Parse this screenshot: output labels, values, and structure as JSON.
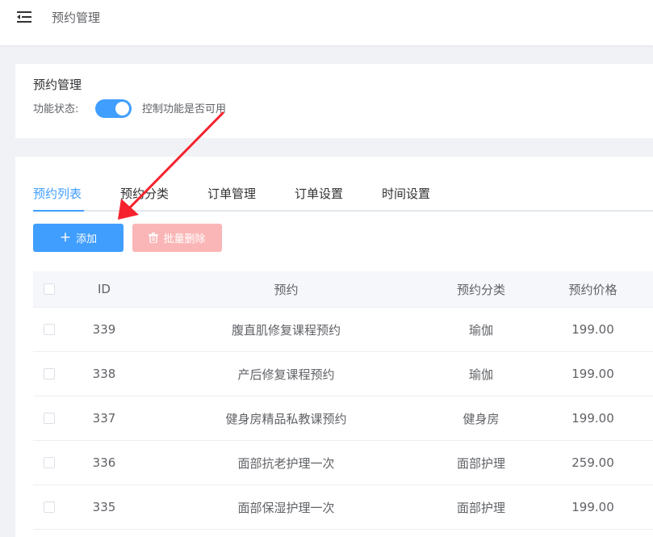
{
  "topbar": {
    "title": "预约管理"
  },
  "section": {
    "title": "预约管理",
    "status_label": "功能状态:",
    "status_desc": "控制功能是否可用",
    "switch_on": true
  },
  "tabs": [
    {
      "label": "预约列表",
      "active": true
    },
    {
      "label": "预约分类"
    },
    {
      "label": "订单管理"
    },
    {
      "label": "订单设置"
    },
    {
      "label": "时间设置"
    }
  ],
  "buttons": {
    "add": "添加",
    "batch_delete": "批量删除"
  },
  "table": {
    "headers": {
      "id": "ID",
      "name": "预约",
      "category": "预约分类",
      "price": "预约价格"
    },
    "rows": [
      {
        "id": "339",
        "name": "腹直肌修复课程预约",
        "category": "瑜伽",
        "price": "199.00"
      },
      {
        "id": "338",
        "name": "产后修复课程预约",
        "category": "瑜伽",
        "price": "199.00"
      },
      {
        "id": "337",
        "name": "健身房精品私教课预约",
        "category": "健身房",
        "price": "199.00"
      },
      {
        "id": "336",
        "name": "面部抗老护理一次",
        "category": "面部护理",
        "price": "259.00"
      },
      {
        "id": "335",
        "name": "面部保湿护理一次",
        "category": "面部护理",
        "price": "199.00"
      }
    ]
  },
  "colors": {
    "primary": "#409eff",
    "danger_disabled": "#fab6b6",
    "annotation_arrow": "#f5222d"
  }
}
